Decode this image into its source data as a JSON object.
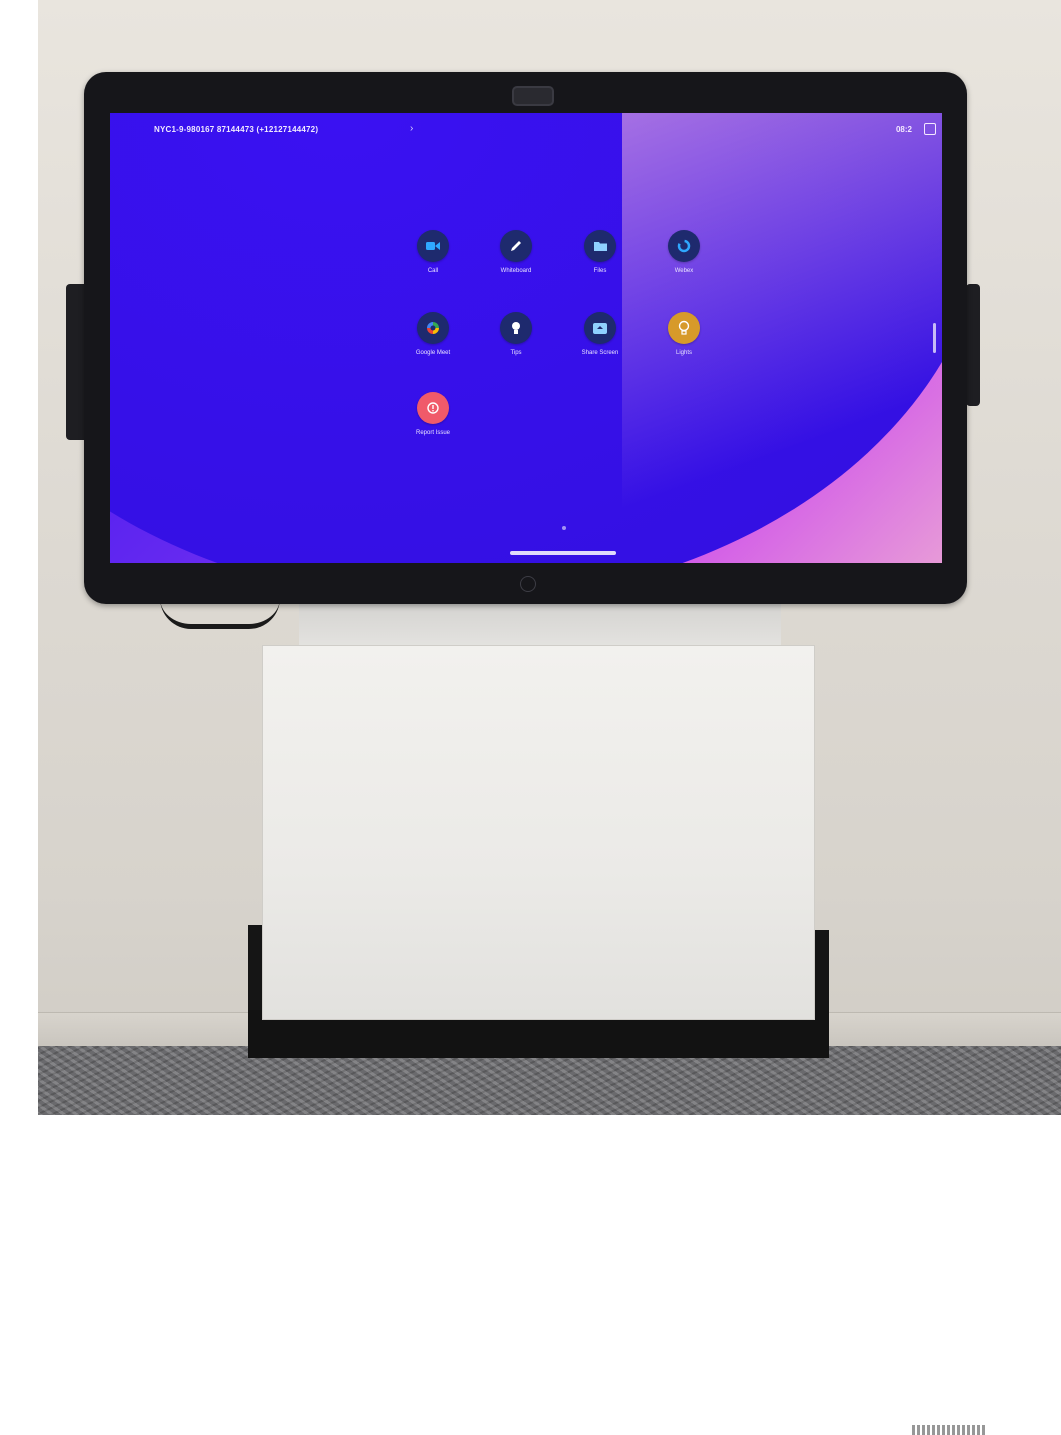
{
  "screen": {
    "meeting_id": "NYC1-9-980167 87144473 (+12127144472)",
    "chevron": "›",
    "clock": "08:2",
    "colors": {
      "background_primary": "#3a11f2",
      "background_secondary": "#e79ad8",
      "tile": "#1e2a6e"
    }
  },
  "apps": [
    {
      "label": "Call",
      "icon": "video-camera-icon",
      "color": "#1e2a6e"
    },
    {
      "label": "Whiteboard",
      "icon": "pencil-icon",
      "color": "#1e2a6e"
    },
    {
      "label": "Files",
      "icon": "folder-icon",
      "color": "#1e2a6e"
    },
    {
      "label": "Webex",
      "icon": "webex-icon",
      "color": "#1e2a6e"
    },
    {
      "label": "Google Meet",
      "icon": "google-meet-icon",
      "color": "#1e2a6e"
    },
    {
      "label": "Tips",
      "icon": "lightbulb-icon",
      "color": "#1e2a6e"
    },
    {
      "label": "Share Screen",
      "icon": "share-screen-icon",
      "color": "#1e2a6e"
    },
    {
      "label": "Lights",
      "icon": "bulb-outline-icon",
      "color": "#d79a2a"
    },
    {
      "label": "Report Issue",
      "icon": "report-icon",
      "color": "#f05a6a"
    }
  ]
}
